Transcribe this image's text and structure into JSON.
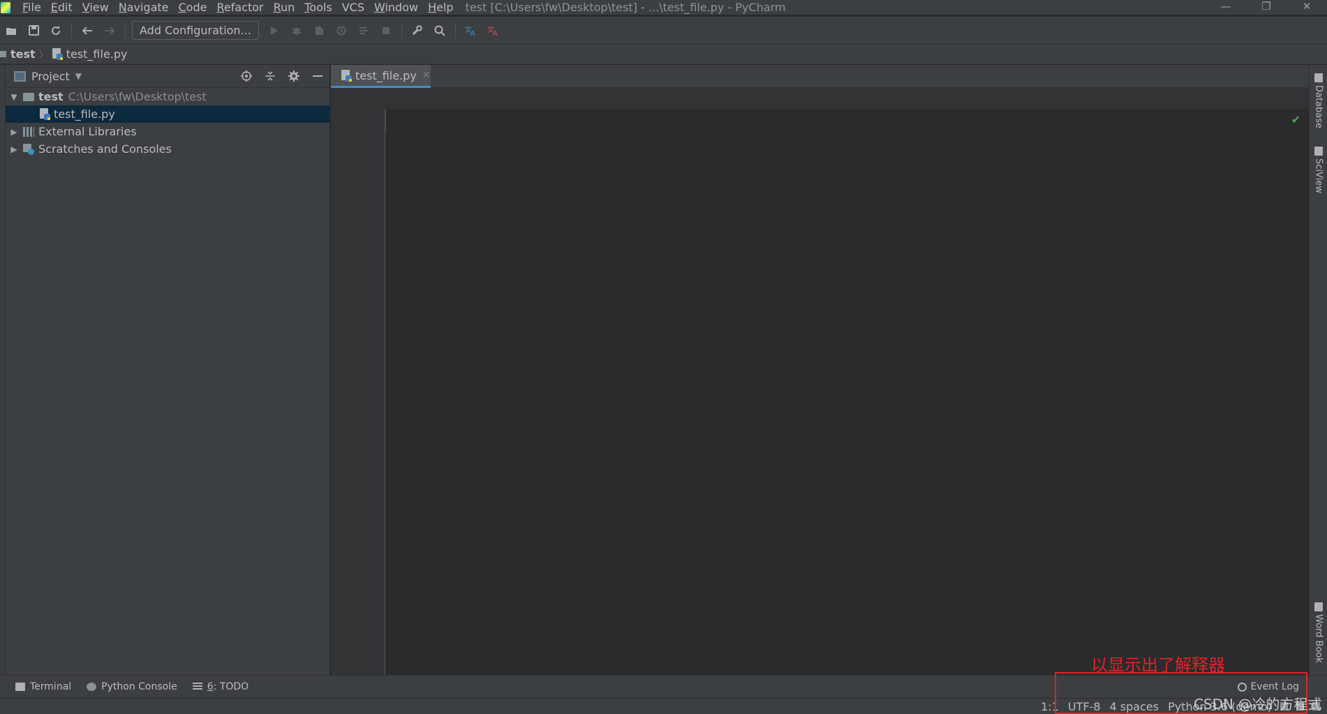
{
  "window": {
    "title": "test [C:\\Users\\fw\\Desktop\\test] - ...\\test_file.py - PyCharm",
    "minimize": "—",
    "restore": "❐",
    "close": "✕"
  },
  "menu": [
    {
      "mnemonic": "F",
      "rest": "ile"
    },
    {
      "mnemonic": "E",
      "rest": "dit"
    },
    {
      "mnemonic": "V",
      "rest": "iew"
    },
    {
      "mnemonic": "N",
      "rest": "avigate"
    },
    {
      "mnemonic": "C",
      "rest": "ode"
    },
    {
      "mnemonic": "R",
      "rest": "efactor"
    },
    {
      "mnemonic": "R",
      "rest": "un"
    },
    {
      "mnemonic": "T",
      "rest": "ools"
    },
    {
      "mnemonic": "",
      "rest": "VCS"
    },
    {
      "mnemonic": "W",
      "rest": "indow"
    },
    {
      "mnemonic": "H",
      "rest": "elp"
    }
  ],
  "toolbar": {
    "add_configuration": "Add Configuration..."
  },
  "breadcrumb": {
    "project": "test",
    "file": "test_file.py"
  },
  "project_panel": {
    "title": "Project",
    "tree": {
      "root_name": "test",
      "root_path": "C:\\Users\\fw\\Desktop\\test",
      "file": "test_file.py",
      "external_libraries": "External Libraries",
      "scratches": "Scratches and Consoles"
    }
  },
  "editor": {
    "tab_label": "test_file.py"
  },
  "right_tools": {
    "database": "Database",
    "sciview": "SciView",
    "wordbook": "Word Book"
  },
  "bottom_tools": {
    "terminal": "Terminal",
    "python_console": "Python Console",
    "todo_num": "6",
    "todo_rest": ": TODO",
    "event_log": "Event Log"
  },
  "status": {
    "position": "1:1",
    "encoding": "UTF-8",
    "indent": "4 spaces",
    "interpreter": "Python 3.6 (demo)"
  },
  "annotation": {
    "text": "以显示出了解释器",
    "color": "#e0232b"
  },
  "watermark": "CSDN @冷的方程式",
  "colors": {
    "accent": "#4a88c7",
    "selection": "#0d293e",
    "inspection_ok": "#5aa35a"
  },
  "icons": [
    "save-icon",
    "sync-icon",
    "back-icon",
    "forward-icon",
    "run-icon",
    "debug-icon",
    "coverage-icon",
    "profile-icon",
    "concurrency-icon",
    "stop-icon",
    "wrench-icon",
    "search-icon",
    "translate-icon",
    "translate-alt-icon",
    "locate-icon",
    "collapse-icon",
    "gear-icon",
    "minimize-icon"
  ]
}
